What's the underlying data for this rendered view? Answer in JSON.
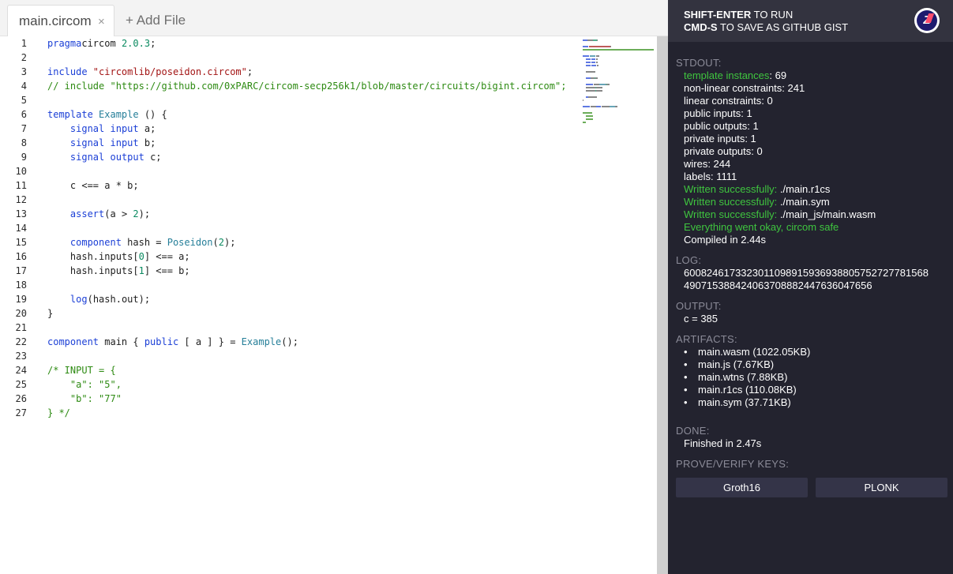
{
  "tabs": {
    "active_label": "main.circom",
    "close_glyph": "×",
    "add_file_label": "+ Add File"
  },
  "code": {
    "lines": [
      [
        [
          "kw",
          "pragma"
        ],
        [
          "",
          "circom "
        ],
        [
          "nm",
          "2.0.3"
        ],
        [
          "",
          ";"
        ]
      ],
      [],
      [
        [
          "kw",
          "include"
        ],
        [
          "",
          ""
        ],
        [
          "st",
          " \"circomlib/poseidon.circom\""
        ],
        [
          "",
          ";"
        ]
      ],
      [
        [
          "cm",
          "// include \"https://github.com/0xPARC/circom-secp256k1/blob/master/circuits/bigint.circom\";"
        ]
      ],
      [],
      [
        [
          "kw",
          "template"
        ],
        [
          "",
          ""
        ],
        [
          "ty",
          " Example"
        ],
        [
          "",
          " () {"
        ]
      ],
      [
        [
          "",
          "    "
        ],
        [
          "kw",
          "signal"
        ],
        [
          "",
          ""
        ],
        [
          "kw",
          " input"
        ],
        [
          "",
          " a;"
        ]
      ],
      [
        [
          "",
          "    "
        ],
        [
          "kw",
          "signal"
        ],
        [
          "",
          ""
        ],
        [
          "kw",
          " input"
        ],
        [
          "",
          " b;"
        ]
      ],
      [
        [
          "",
          "    "
        ],
        [
          "kw",
          "signal"
        ],
        [
          "",
          ""
        ],
        [
          "kw",
          " output"
        ],
        [
          "",
          " c;"
        ]
      ],
      [],
      [
        [
          "",
          "    c <== a * b;"
        ]
      ],
      [],
      [
        [
          "",
          "    "
        ],
        [
          "kw",
          "assert"
        ],
        [
          "",
          "(a > "
        ],
        [
          "nm",
          "2"
        ],
        [
          "",
          "); "
        ]
      ],
      [],
      [
        [
          "",
          "    "
        ],
        [
          "kw",
          "component"
        ],
        [
          "",
          " hash = "
        ],
        [
          "ty",
          "Poseidon"
        ],
        [
          "",
          "("
        ],
        [
          "nm",
          "2"
        ],
        [
          "",
          "); "
        ]
      ],
      [
        [
          "",
          "    hash.inputs["
        ],
        [
          "nm",
          "0"
        ],
        [
          "",
          "] <== a;"
        ]
      ],
      [
        [
          "",
          "    hash.inputs["
        ],
        [
          "nm",
          "1"
        ],
        [
          "",
          "] <== b;"
        ]
      ],
      [],
      [
        [
          "",
          "    "
        ],
        [
          "kw",
          "log"
        ],
        [
          "",
          "(hash.out);"
        ]
      ],
      [
        [
          "",
          "}"
        ]
      ],
      [],
      [
        [
          "kw",
          "component"
        ],
        [
          "",
          " main { "
        ],
        [
          "kw",
          "public"
        ],
        [
          "",
          " [ a ] } = "
        ],
        [
          "ty",
          "Example"
        ],
        [
          "",
          "();"
        ]
      ],
      [],
      [
        [
          "cm",
          "/* INPUT = {"
        ]
      ],
      [
        [
          "cm",
          "    \"a\": \"5\","
        ]
      ],
      [
        [
          "cm",
          "    \"b\": \"77\""
        ]
      ],
      [
        [
          "cm",
          "} */"
        ]
      ]
    ]
  },
  "panel": {
    "hint_line1_bold": "SHIFT-ENTER",
    "hint_line1_rest": " TO RUN",
    "hint_line2_bold": "CMD-S",
    "hint_line2_rest": " TO SAVE AS GITHUB GIST",
    "logo_text": "Z",
    "stdout_title": "STDOUT:",
    "stdout_lines": [
      {
        "label": "template instances",
        "value": ": 69",
        "label_color": "green"
      },
      {
        "label": "non-linear constraints: 241",
        "value": "",
        "label_color": "white"
      },
      {
        "label": "linear constraints: 0",
        "value": "",
        "label_color": "white"
      },
      {
        "label": "public inputs: 1",
        "value": "",
        "label_color": "white"
      },
      {
        "label": "public outputs: 1",
        "value": "",
        "label_color": "white"
      },
      {
        "label": "private inputs: 1",
        "value": "",
        "label_color": "white"
      },
      {
        "label": "private outputs: 0",
        "value": "",
        "label_color": "white"
      },
      {
        "label": "wires: 244",
        "value": "",
        "label_color": "white"
      },
      {
        "label": "labels: 1111",
        "value": "",
        "label_color": "white"
      },
      {
        "label": "Written successfully:",
        "value": " ./main.r1cs",
        "label_color": "green"
      },
      {
        "label": "Written successfully:",
        "value": " ./main.sym",
        "label_color": "green"
      },
      {
        "label": "Written successfully:",
        "value": " ./main_js/main.wasm",
        "label_color": "green"
      },
      {
        "label": "Everything went okay, circom safe",
        "value": "",
        "label_color": "green"
      },
      {
        "label": "Compiled in 2.44s",
        "value": "",
        "label_color": "white"
      }
    ],
    "log_title": "LOG:",
    "log_lines": [
      "60082461733230110989159369388057527277815​68",
      "4907153884240637088824476360​47656"
    ],
    "output_title": "OUTPUT:",
    "output_value": "c = 385",
    "artifacts_title": "ARTIFACTS:",
    "artifacts": [
      "main.wasm (1022.05KB)",
      "main.js (7.67KB)",
      "main.wtns (7.88KB)",
      "main.r1cs (110.08KB)",
      "main.sym (37.71KB)"
    ],
    "bullet_glyph": "•",
    "done_title": "DONE:",
    "done_value": "Finished in 2.47s",
    "keys_title": "PROVE/VERIFY KEYS:",
    "groth16_label": "Groth16",
    "plonk_label": "PLONK"
  }
}
